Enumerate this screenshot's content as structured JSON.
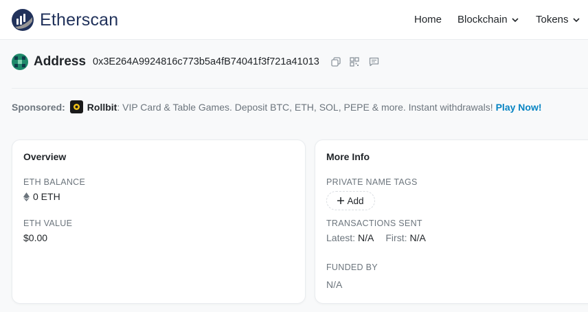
{
  "brand": {
    "name": "Etherscan"
  },
  "nav": {
    "home": "Home",
    "blockchain": "Blockchain",
    "tokens": "Tokens"
  },
  "address": {
    "label": "Address",
    "hash": "0x3E264A9924816c773b5a4fB74041f3f721a41013"
  },
  "sponsor": {
    "label": "Sponsored:",
    "brand": "Rollbit",
    "text": ": VIP Card & Table Games. Deposit BTC, ETH, SOL, PEPE & more. Instant withdrawals!",
    "cta": "Play Now!"
  },
  "overview": {
    "title": "Overview",
    "eth_balance_label": "ETH BALANCE",
    "eth_balance_value": "0 ETH",
    "eth_value_label": "ETH VALUE",
    "eth_value_value": "$0.00"
  },
  "more_info": {
    "title": "More Info",
    "private_tags_label": "PRIVATE NAME TAGS",
    "add_label": "Add",
    "tx_sent_label": "TRANSACTIONS SENT",
    "latest_label": "Latest:",
    "latest_value": "N/A",
    "first_label": "First:",
    "first_value": "N/A",
    "funded_by_label": "FUNDED BY",
    "funded_by_value": "N/A"
  },
  "colors": {
    "brand": "#21325b",
    "link": "#0784c3",
    "muted": "#6c757d"
  }
}
